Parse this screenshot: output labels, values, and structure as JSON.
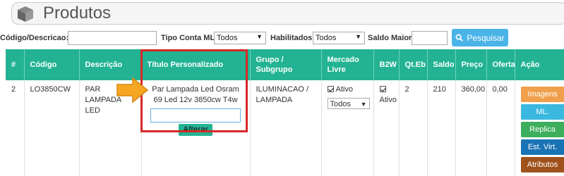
{
  "header": {
    "title": "Produtos",
    "icon": "cube-icon"
  },
  "filters": {
    "codigo_label": "Código/Descricao:",
    "codigo_value": "",
    "tipo_conta_label": "Tipo Conta ML:",
    "tipo_conta_value": "Todos",
    "habilitados_label": "Habilitados:",
    "habilitados_value": "Todos",
    "saldo_label": "Saldo Maior:",
    "saldo_value": "",
    "search_label": "Pesquisar"
  },
  "table": {
    "columns": [
      "#",
      "Código",
      "Descrição",
      "Título Personalizado",
      "Grupo / Subgrupo",
      "Mercado Livre",
      "B2W",
      "Qt.Eb",
      "Saldo",
      "Preço",
      "Oferta",
      "Ação"
    ],
    "rows": [
      {
        "num": "2",
        "codigo": "LO3850CW",
        "descricao": "PAR LAMPADA LED",
        "titulo": "Par Lampada Led Osram 69 Led 12v 3850cw T4w",
        "titulo_input": "",
        "alterar_label": "Alterar",
        "grupo": "ILUMINACAO / LAMPADA",
        "ml_ativo_label": "Ativo",
        "ml_select_value": "Todos",
        "b2w_ativo_label": "Ativo",
        "qteb": "2",
        "saldo": "210",
        "preco": "360,00",
        "oferta": "0,00",
        "actions": [
          {
            "label": "Imagens",
            "color": "#f0a04b"
          },
          {
            "label": "ML.",
            "color": "#3bb8e0"
          },
          {
            "label": "Replica",
            "color": "#3cae5c"
          },
          {
            "label": "Est. Virt.",
            "color": "#1a73b5"
          },
          {
            "label": "Atributos",
            "color": "#a0521c"
          }
        ]
      }
    ]
  },
  "colors": {
    "header_green": "#23b393",
    "highlight_red": "#d62828",
    "arrow_orange": "#f5a623"
  }
}
